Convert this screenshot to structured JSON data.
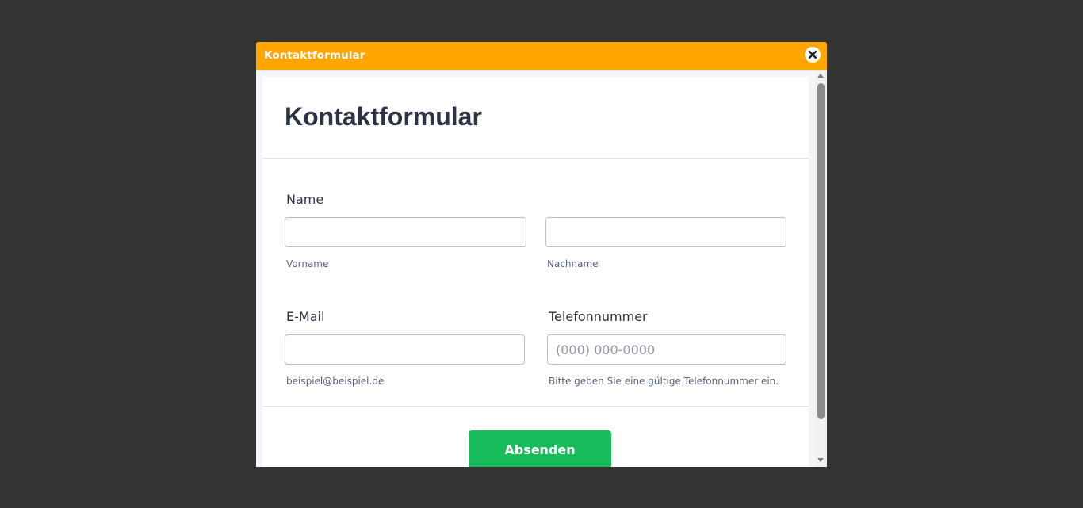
{
  "dialog": {
    "title": "Kontaktformular",
    "close_icon": "close-icon",
    "accent_color": "#FFA500"
  },
  "form": {
    "heading": "Kontaktformular",
    "name": {
      "label": "Name",
      "first": {
        "value": "",
        "placeholder": "",
        "sublabel": "Vorname"
      },
      "last": {
        "value": "",
        "placeholder": "",
        "sublabel": "Nachname"
      }
    },
    "email": {
      "label": "E-Mail",
      "value": "",
      "placeholder": "",
      "sublabel": "beispiel@beispiel.de"
    },
    "phone": {
      "label": "Telefonnummer",
      "value": "",
      "placeholder": "(000) 000-0000",
      "sublabel": "Bitte geben Sie eine gültige Telefonnummer ein."
    },
    "submit_label": "Absenden",
    "submit_color": "#18bd5b"
  }
}
